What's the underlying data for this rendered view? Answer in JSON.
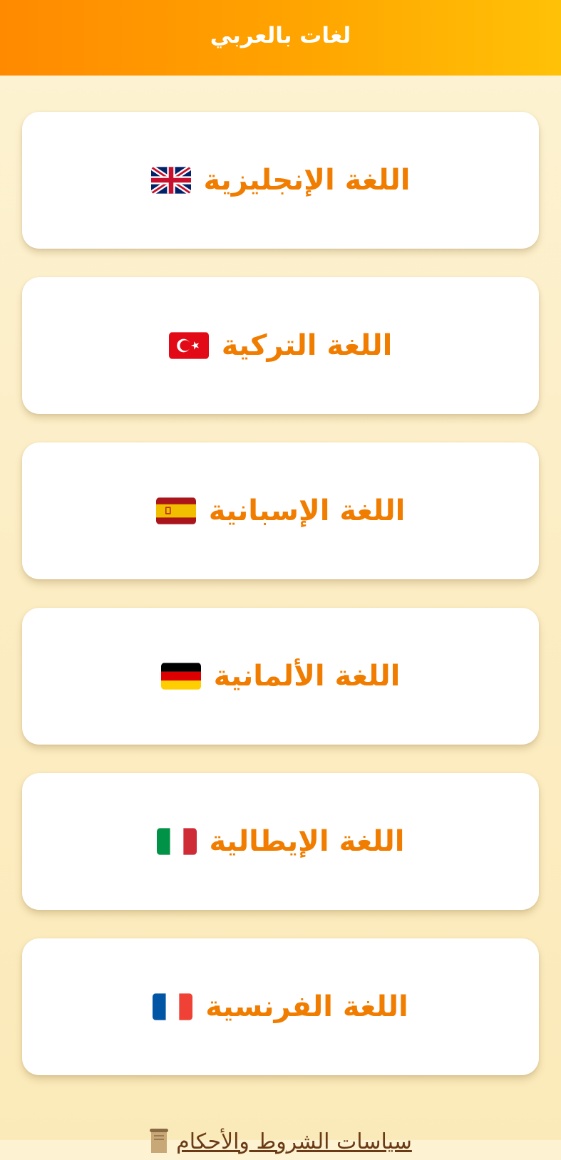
{
  "app_bar": {
    "title": "لغات بالعربي"
  },
  "languages": [
    {
      "label": "اللغة الإنجليزية",
      "flag": "uk-flag-icon"
    },
    {
      "label": "اللغة التركية",
      "flag": "turkey-flag-icon"
    },
    {
      "label": "اللغة الإسبانية",
      "flag": "spain-flag-icon"
    },
    {
      "label": "اللغة الألمانية",
      "flag": "germany-flag-icon"
    },
    {
      "label": "اللغة الإيطالية",
      "flag": "italy-flag-icon"
    },
    {
      "label": "اللغة الفرنسية",
      "flag": "france-flag-icon"
    }
  ],
  "footer": {
    "link_text": "سياسات الشروط والأحكام",
    "icon": "scroll-icon"
  },
  "colors": {
    "app_bar_start": "#ff8a00",
    "app_bar_end": "#ffc107",
    "card_text": "#f07d00",
    "background": "#fdf3d3"
  }
}
